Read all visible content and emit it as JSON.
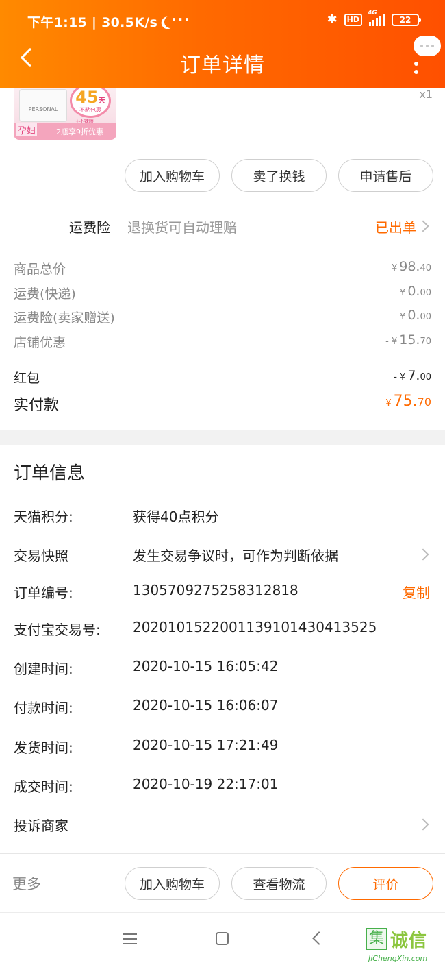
{
  "status_bar": {
    "time_speed": "下午1:15 | 30.5K/s",
    "more": "···",
    "hd": "HD",
    "network": "4G",
    "battery": "22"
  },
  "header": {
    "title": "订单详情"
  },
  "product": {
    "thumb_days": "45",
    "thumb_day_unit": "天",
    "thumb_brand": "PERSONAL",
    "thumb_no_bag": "不粘包裹",
    "thumb_note": "+不辣眼",
    "thumb_pregnant": "孕妇",
    "thumb_offer": "2瓶享9折优惠",
    "quantity": "x1"
  },
  "item_actions": [
    "加入购物车",
    "卖了换钱",
    "申请售后"
  ],
  "insurance": {
    "label": "运费险",
    "desc": "退换货可自动理赔",
    "status": "已出单"
  },
  "prices": [
    {
      "label": "商品总价",
      "prefix": "",
      "yen": "¥",
      "int": "98.",
      "dec": "40"
    },
    {
      "label": "运费(快递)",
      "prefix": "",
      "yen": "¥",
      "int": "0.",
      "dec": "00"
    },
    {
      "label": "运费险(卖家赠送)",
      "prefix": "",
      "yen": "¥",
      "int": "0.",
      "dec": "00"
    },
    {
      "label": "店铺优惠",
      "prefix": "- ",
      "yen": "¥",
      "int": "15.",
      "dec": "70"
    }
  ],
  "red_packet": {
    "label": "红包",
    "prefix": "- ",
    "yen": "¥",
    "int": "7.",
    "dec": "00"
  },
  "total": {
    "label": "实付款",
    "yen": "¥",
    "int": "75.",
    "dec": "70"
  },
  "order_info": {
    "title": "订单信息",
    "rows": [
      {
        "label": "天猫积分:",
        "value": "获得40点积分"
      },
      {
        "label": "交易快照",
        "value": "发生交易争议时，可作为判断依据"
      },
      {
        "label": "订单编号:",
        "value": "1305709275258312818",
        "action": "复制"
      },
      {
        "label": "支付宝交易号:",
        "value": "2020101522001139101430413525"
      },
      {
        "label": "创建时间:",
        "value": "2020-10-15 16:05:42"
      },
      {
        "label": "付款时间:",
        "value": "2020-10-15 16:06:07"
      },
      {
        "label": "发货时间:",
        "value": "2020-10-15 17:21:49"
      },
      {
        "label": "成交时间:",
        "value": "2020-10-19 22:17:01"
      },
      {
        "label": "投诉商家",
        "value": ""
      }
    ]
  },
  "bottom_bar": {
    "more": "更多",
    "buttons": [
      "加入购物车",
      "查看物流",
      "评价"
    ]
  },
  "watermark": {
    "cn": "诚信",
    "en": "JiChengXin.com",
    "logo": "集"
  },
  "colors": {
    "accent": "#ff6a00",
    "header_start": "#ff8a00",
    "header_end": "#ff5000"
  }
}
